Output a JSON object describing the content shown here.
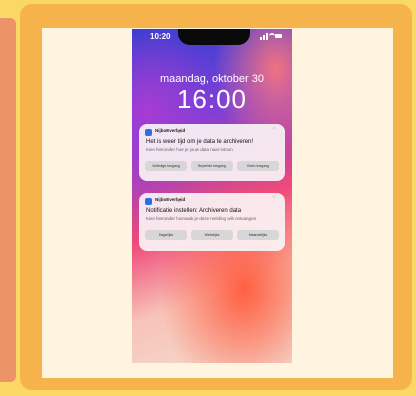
{
  "phone": {
    "status_time": "10:20",
    "lock_date": "maandag, oktober 30",
    "lock_time": "16:00"
  },
  "notifications": [
    {
      "app_name": "NijboEverheid",
      "time": "nu",
      "title": "Het is weer tijd om je data te archiveren!",
      "body": "Kies hieronder hoe je jouw data naar intoon",
      "buttons": [
        "Volledige toegang",
        "Beperkte toegang",
        "Geen toegang"
      ]
    },
    {
      "app_name": "NijboEverheid",
      "time": "nu",
      "title": "Notificatie instellen: Archiveren data",
      "body": "Kies hieronder hoevaak je deze melding wilt ontvangen",
      "buttons": [
        "Dagelijks",
        "Wekelijks",
        "Maandelijks"
      ]
    }
  ],
  "colors": {
    "frame_yellow": "#fbd866",
    "card_orange": "#f6b24b",
    "side_panel": "#ec9467",
    "cream": "#fff4df",
    "app_icon": "#2b6fe0"
  }
}
